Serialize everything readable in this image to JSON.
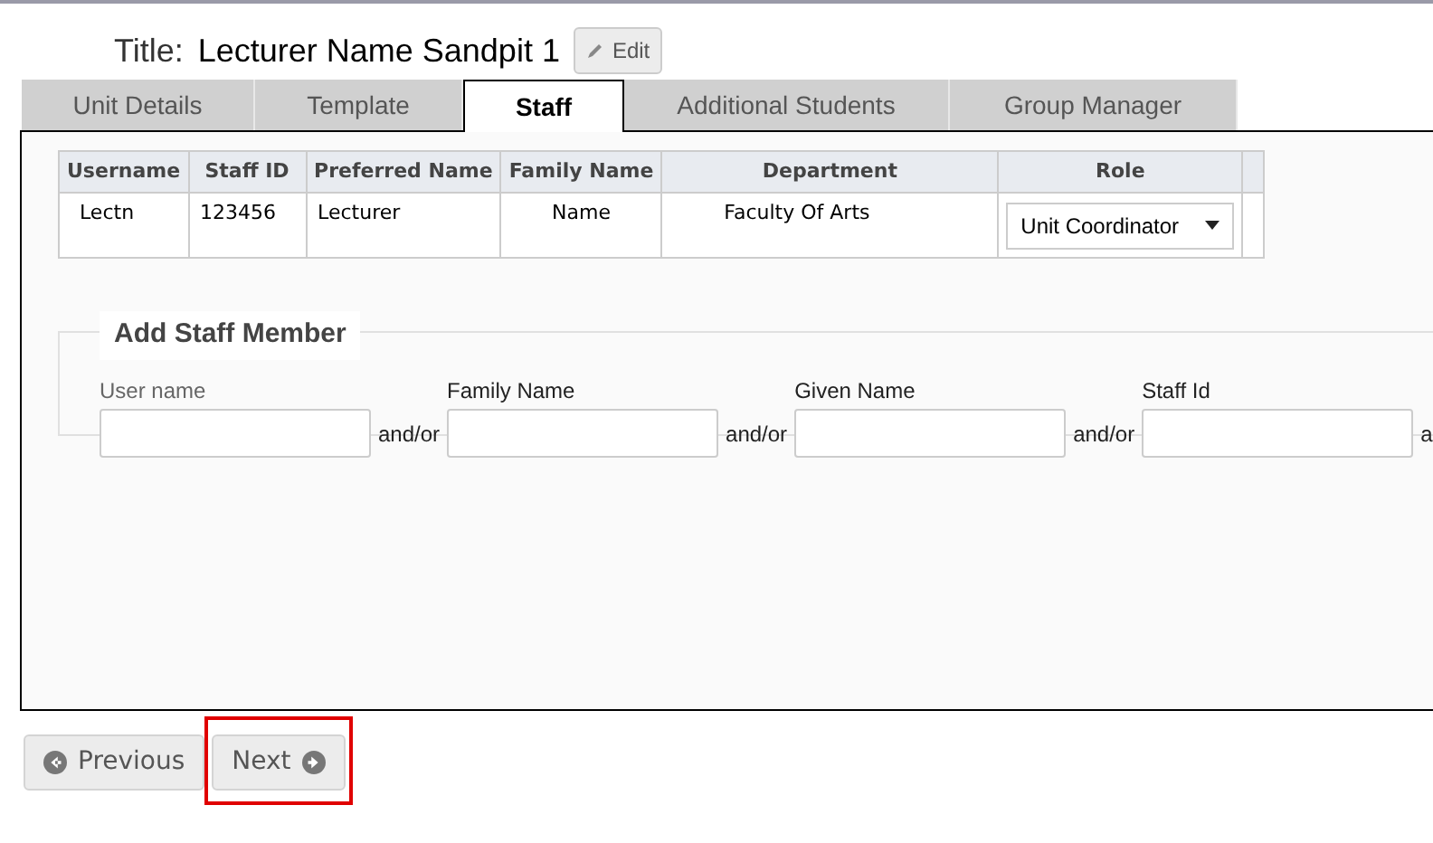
{
  "title": {
    "label": "Title:",
    "value": "Lecturer Name Sandpit 1",
    "edit_button": "Edit"
  },
  "tabs": [
    {
      "label": "Unit Details",
      "selected": false
    },
    {
      "label": "Template",
      "selected": false
    },
    {
      "label": "Staff",
      "selected": true
    },
    {
      "label": "Additional Students",
      "selected": false
    },
    {
      "label": "Group Manager",
      "selected": false
    }
  ],
  "staff_table": {
    "columns": [
      "Username",
      "Staff ID",
      "Preferred Name",
      "Family Name",
      "Department",
      "Role"
    ],
    "rows": [
      {
        "username": "Lectn",
        "staff_id": "123456",
        "preferred_name": "Lecturer",
        "family_name": "Name",
        "department": "Faculty Of Arts",
        "role": "Unit Coordinator"
      }
    ]
  },
  "add_staff": {
    "legend": "Add Staff Member",
    "fields": [
      {
        "label": "User name",
        "joiner": "and/or"
      },
      {
        "label": "Family Name",
        "joiner": "and/or"
      },
      {
        "label": "Given Name",
        "joiner": "and/or"
      },
      {
        "label": "Staff Id",
        "joiner": "a"
      }
    ]
  },
  "buttons": [
    {
      "kind": "previous",
      "label": "Previous",
      "highlighted": false
    },
    {
      "kind": "next",
      "label": "Next",
      "highlighted": true
    }
  ]
}
